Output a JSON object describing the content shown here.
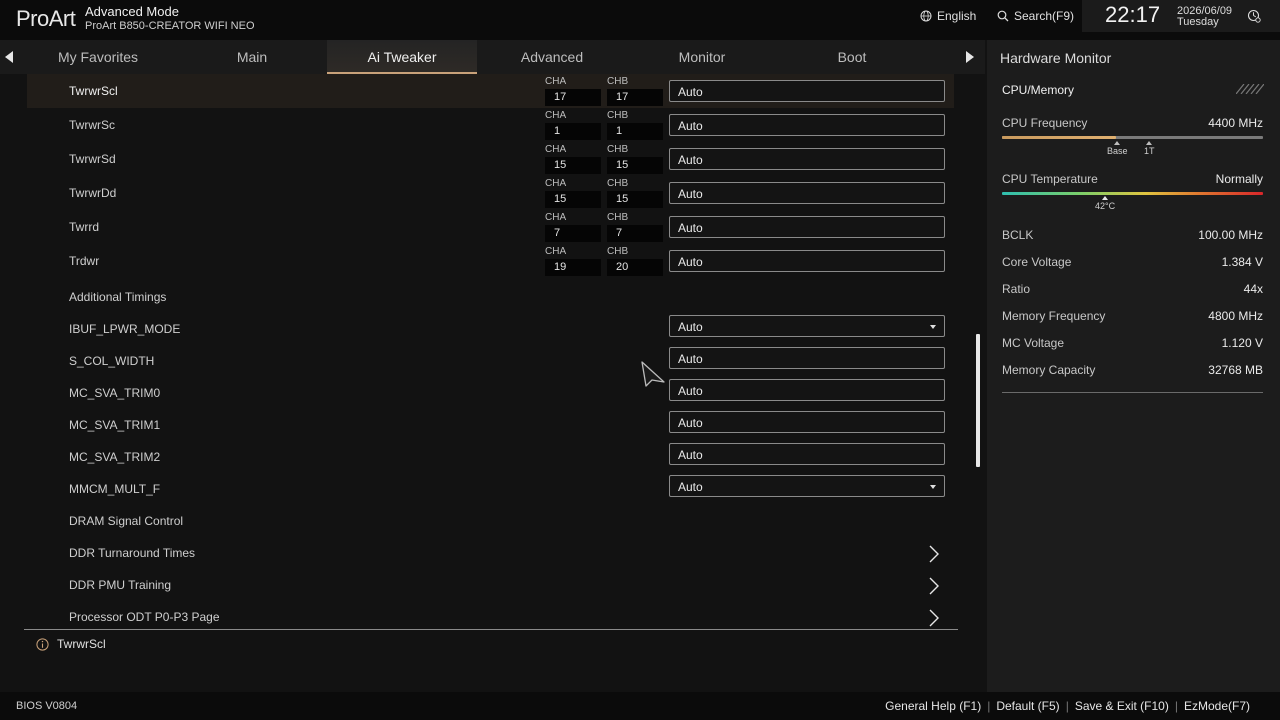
{
  "header": {
    "logo": "ProArt",
    "mode": "Advanced Mode",
    "model": "ProArt B850-CREATOR WIFI NEO",
    "language": "English",
    "search": "Search(F9)",
    "time": "22:17",
    "date": "2026/06/09",
    "weekday": "Tuesday"
  },
  "tabs": [
    "My Favorites",
    "Main",
    "Ai Tweaker",
    "Advanced",
    "Monitor",
    "Boot"
  ],
  "channel_labels": {
    "a": "CHA",
    "b": "CHB"
  },
  "timing_rows": [
    {
      "label": "TwrwrScl",
      "cha": "17",
      "chb": "17",
      "value": "Auto"
    },
    {
      "label": "TwrwrSc",
      "cha": "1",
      "chb": "1",
      "value": "Auto"
    },
    {
      "label": "TwrwrSd",
      "cha": "15",
      "chb": "15",
      "value": "Auto"
    },
    {
      "label": "TwrwrDd",
      "cha": "15",
      "chb": "15",
      "value": "Auto"
    },
    {
      "label": "Twrrd",
      "cha": "7",
      "chb": "7",
      "value": "Auto"
    },
    {
      "label": "Trdwr",
      "cha": "19",
      "chb": "20",
      "value": "Auto"
    }
  ],
  "additional_timings": "Additional Timings",
  "option_rows": [
    {
      "label": "IBUF_LPWR_MODE",
      "value": "Auto",
      "dropdown": true
    },
    {
      "label": "S_COL_WIDTH",
      "value": "Auto",
      "dropdown": false
    },
    {
      "label": "MC_SVA_TRIM0",
      "value": "Auto",
      "dropdown": false
    },
    {
      "label": "MC_SVA_TRIM1",
      "value": "Auto",
      "dropdown": false
    },
    {
      "label": "MC_SVA_TRIM2",
      "value": "Auto",
      "dropdown": false
    },
    {
      "label": "MMCM_MULT_F",
      "value": "Auto",
      "dropdown": true
    }
  ],
  "dram_signal": "DRAM Signal Control",
  "submenus": [
    "DDR Turnaround Times",
    "DDR PMU Training",
    "Processor ODT P0-P3 Page"
  ],
  "help_text": "TwrwrScl",
  "hardware_monitor": {
    "title": "Hardware Monitor",
    "section": "CPU/Memory",
    "cpu_frequency_label": "CPU Frequency",
    "cpu_frequency_value": "4400 MHz",
    "freq_markers": [
      "Base",
      "1T"
    ],
    "cpu_temp_label": "CPU Temperature",
    "cpu_temp_value": "Normally",
    "cpu_temp_marker": "42°C",
    "stats": [
      {
        "label": "BCLK",
        "value": "100.00 MHz"
      },
      {
        "label": "Core Voltage",
        "value": "1.384 V"
      },
      {
        "label": "Ratio",
        "value": "44x"
      },
      {
        "label": "Memory Frequency",
        "value": "4800 MHz"
      },
      {
        "label": "MC Voltage",
        "value": "1.120 V"
      },
      {
        "label": "Memory Capacity",
        "value": "32768 MB"
      }
    ]
  },
  "footer": {
    "version": "BIOS V0804",
    "keys": [
      "General Help (F1)",
      "Default (F5)",
      "Save & Exit (F10)",
      "EzMode(F7)"
    ]
  },
  "colors": {
    "accent": "#c9a27a",
    "highlight_row": "#211d19",
    "panel": "#1c1c1c"
  }
}
